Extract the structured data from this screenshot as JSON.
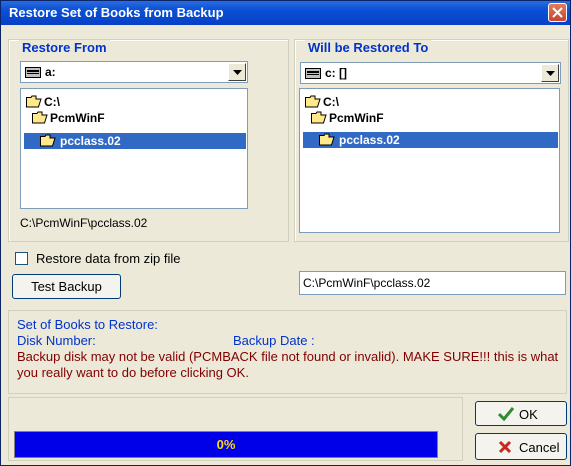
{
  "window": {
    "title": "Restore Set of Books from Backup"
  },
  "restore_from": {
    "legend": "Restore From",
    "drive": "a:",
    "tree": [
      {
        "label": "C:\\",
        "icon": "folder-open-icon"
      },
      {
        "label": "PcmWinF",
        "icon": "folder-open-icon"
      },
      {
        "label": "pcclass.02",
        "icon": "folder-open-icon",
        "selected": true
      }
    ],
    "path": "C:\\PcmWinF\\pcclass.02"
  },
  "restore_to": {
    "legend": "Will be Restored To",
    "drive": "c: []",
    "tree": [
      {
        "label": "C:\\",
        "icon": "folder-open-icon"
      },
      {
        "label": "PcmWinF",
        "icon": "folder-open-icon"
      },
      {
        "label": "pcclass.02",
        "icon": "folder-open-icon",
        "selected": true
      }
    ],
    "path": "C:\\PcmWinF\\pcclass.02"
  },
  "zip_checkbox": {
    "label": "Restore data from zip file",
    "checked": false
  },
  "test_backup_label": "Test Backup",
  "info": {
    "set_label": "Set of Books to Restore:",
    "disk_label": "Disk Number:",
    "date_label": "Backup Date :",
    "warning": "Backup disk may not be valid (PCMBACK file not found or invalid).  MAKE SURE!!! this is what you really want to do before clicking OK."
  },
  "progress": {
    "value": 0,
    "text": "0%"
  },
  "buttons": {
    "ok": "OK",
    "cancel": "Cancel"
  },
  "colors": {
    "accent": "#0033CC",
    "warning": "#800000",
    "progress_fill": "#0000E8",
    "progress_text": "#FFD800"
  }
}
